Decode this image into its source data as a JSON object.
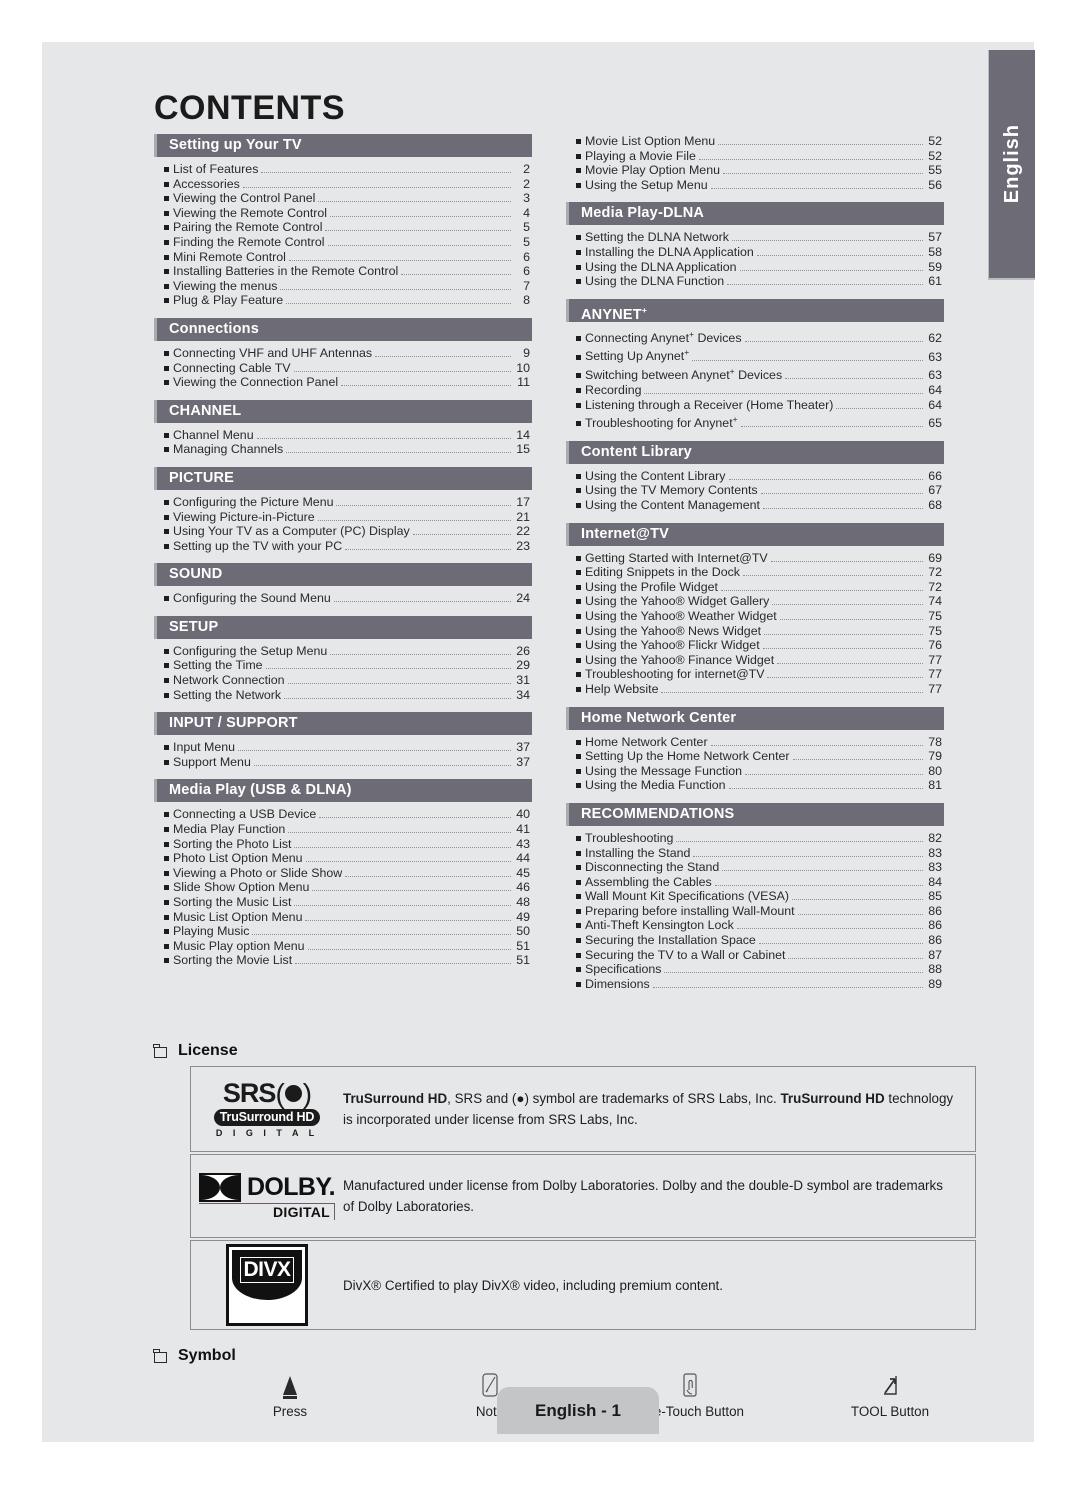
{
  "page": {
    "title": "CONTENTS",
    "language_tab": "English",
    "footer": "English - 1"
  },
  "toc": {
    "left_column": [
      {
        "header": "Setting up Your TV",
        "entries": [
          {
            "title": "List of Features",
            "page": "2"
          },
          {
            "title": "Accessories",
            "page": "2"
          },
          {
            "title": "Viewing the Control Panel",
            "page": "3"
          },
          {
            "title": "Viewing the Remote Control",
            "page": "4"
          },
          {
            "title": "Pairing the Remote Control",
            "page": "5"
          },
          {
            "title": "Finding the Remote Control",
            "page": "5"
          },
          {
            "title": "Mini Remote Control",
            "page": "6"
          },
          {
            "title": "Installing Batteries in the Remote Control",
            "page": "6"
          },
          {
            "title": "Viewing the menus",
            "page": "7"
          },
          {
            "title": "Plug & Play Feature",
            "page": "8"
          }
        ]
      },
      {
        "header": "Connections",
        "entries": [
          {
            "title": "Connecting VHF and UHF Antennas",
            "page": "9"
          },
          {
            "title": "Connecting Cable TV",
            "page": "10"
          },
          {
            "title": "Viewing the Connection Panel",
            "page": "11"
          }
        ]
      },
      {
        "header": "CHANNEL",
        "entries": [
          {
            "title": "Channel Menu",
            "page": "14"
          },
          {
            "title": "Managing Channels",
            "page": "15"
          }
        ]
      },
      {
        "header": "PICTURE",
        "entries": [
          {
            "title": "Configuring the Picture Menu",
            "page": "17"
          },
          {
            "title": "Viewing Picture-in-Picture",
            "page": "21"
          },
          {
            "title": "Using Your TV as a Computer (PC) Display",
            "page": "22"
          },
          {
            "title": "Setting up the TV with your PC",
            "page": "23"
          }
        ]
      },
      {
        "header": "SOUND",
        "entries": [
          {
            "title": "Configuring the Sound Menu",
            "page": "24"
          }
        ]
      },
      {
        "header": "SETUP",
        "entries": [
          {
            "title": "Configuring the Setup Menu",
            "page": "26"
          },
          {
            "title": "Setting the Time",
            "page": "29"
          },
          {
            "title": "Network Connection",
            "page": "31"
          },
          {
            "title": "Setting the Network",
            "page": "34"
          }
        ]
      },
      {
        "header": "INPUT / SUPPORT",
        "entries": [
          {
            "title": "Input Menu",
            "page": "37"
          },
          {
            "title": "Support Menu",
            "page": "37"
          }
        ]
      },
      {
        "header": "Media Play (USB & DLNA)",
        "entries": [
          {
            "title": "Connecting a USB Device",
            "page": "40"
          },
          {
            "title": "Media Play Function",
            "page": "41"
          },
          {
            "title": "Sorting the Photo List",
            "page": "43"
          },
          {
            "title": "Photo List Option Menu",
            "page": "44"
          },
          {
            "title": "Viewing a Photo or Slide Show",
            "page": "45"
          },
          {
            "title": "Slide Show Option Menu",
            "page": "46"
          },
          {
            "title": "Sorting the Music List",
            "page": "48"
          },
          {
            "title": "Music List Option Menu",
            "page": "49"
          },
          {
            "title": "Playing Music",
            "page": "50"
          },
          {
            "title": "Music Play option Menu",
            "page": "51"
          },
          {
            "title": "Sorting the Movie List",
            "page": "51"
          }
        ]
      }
    ],
    "right_column": [
      {
        "header": "",
        "entries": [
          {
            "title": "Movie List Option Menu",
            "page": "52"
          },
          {
            "title": "Playing a Movie File",
            "page": "52"
          },
          {
            "title": "Movie Play Option Menu",
            "page": "55"
          },
          {
            "title": "Using the Setup Menu",
            "page": "56"
          }
        ]
      },
      {
        "header": "Media Play-DLNA",
        "entries": [
          {
            "title": "Setting the DLNA Network",
            "page": "57"
          },
          {
            "title": "Installing the DLNA Application",
            "page": "58"
          },
          {
            "title": "Using the DLNA Application",
            "page": "59"
          },
          {
            "title": "Using the DLNA Function",
            "page": "61"
          }
        ]
      },
      {
        "header": "ANYNET+",
        "header_sup": "+",
        "header_base": "ANYNET",
        "entries": [
          {
            "title": "Connecting Anynet+ Devices",
            "page": "62",
            "base": "Connecting Anynet",
            "sup": "+",
            "rest": " Devices"
          },
          {
            "title": "Setting Up Anynet+",
            "page": "63",
            "base": "Setting Up Anynet",
            "sup": "+",
            "rest": ""
          },
          {
            "title": "Switching between Anynet+ Devices",
            "page": "63",
            "base": "Switching between Anynet",
            "sup": "+",
            "rest": " Devices"
          },
          {
            "title": "Recording",
            "page": "64"
          },
          {
            "title": "Listening through a Receiver (Home Theater)",
            "page": "64"
          },
          {
            "title": "Troubleshooting for Anynet+",
            "page": "65",
            "base": "Troubleshooting for Anynet",
            "sup": "+",
            "rest": ""
          }
        ]
      },
      {
        "header": "Content Library",
        "entries": [
          {
            "title": "Using the Content Library",
            "page": "66"
          },
          {
            "title": "Using the TV Memory Contents",
            "page": "67"
          },
          {
            "title": "Using the Content Management",
            "page": "68"
          }
        ]
      },
      {
        "header": "Internet@TV",
        "entries": [
          {
            "title": "Getting Started with Internet@TV",
            "page": "69"
          },
          {
            "title": "Editing Snippets in the Dock",
            "page": "72"
          },
          {
            "title": "Using the Profile Widget",
            "page": "72"
          },
          {
            "title": "Using the Yahoo® Widget Gallery",
            "page": "74"
          },
          {
            "title": "Using the Yahoo® Weather Widget",
            "page": "75"
          },
          {
            "title": "Using the Yahoo® News Widget",
            "page": "75"
          },
          {
            "title": "Using the Yahoo® Flickr Widget",
            "page": "76"
          },
          {
            "title": "Using the Yahoo® Finance Widget",
            "page": "77"
          },
          {
            "title": "Troubleshooting for internet@TV",
            "page": "77"
          },
          {
            "title": "Help Website",
            "page": "77"
          }
        ]
      },
      {
        "header": "Home Network Center",
        "entries": [
          {
            "title": "Home Network Center",
            "page": "78"
          },
          {
            "title": "Setting Up the Home Network Center",
            "page": "79"
          },
          {
            "title": "Using the Message Function",
            "page": "80"
          },
          {
            "title": "Using the Media Function",
            "page": "81"
          }
        ]
      },
      {
        "header": "RECOMMENDATIONS",
        "entries": [
          {
            "title": "Troubleshooting",
            "page": "82"
          },
          {
            "title": "Installing the Stand",
            "page": "83"
          },
          {
            "title": "Disconnecting the Stand",
            "page": "83"
          },
          {
            "title": "Assembling the Cables",
            "page": "84"
          },
          {
            "title": "Wall Mount Kit Specifications (VESA)",
            "page": "85"
          },
          {
            "title": "Preparing before installing Wall-Mount",
            "page": "86"
          },
          {
            "title": "Anti-Theft Kensington Lock",
            "page": "86"
          },
          {
            "title": "Securing the Installation Space",
            "page": "86"
          },
          {
            "title": "Securing the TV to a Wall or Cabinet",
            "page": "87"
          },
          {
            "title": "Specifications",
            "page": "88"
          },
          {
            "title": "Dimensions",
            "page": "89"
          }
        ]
      }
    ]
  },
  "license": {
    "heading": "License",
    "items": [
      {
        "logo": "srs-trusurround-hd-logo",
        "logo_text": {
          "line1": "SRS",
          "line2": "TruSurround HD",
          "line3": "D I G I T A L"
        },
        "text_html": "TruSurround HD, SRS and (●) symbol are trademarks of SRS Labs, Inc. TruSurround HD technology is incorporated under license from SRS Labs, Inc.",
        "text_part1": "TruSurround HD",
        "text_part2": ", SRS and ",
        "text_part3": " symbol are trademarks of SRS Labs, Inc. ",
        "text_part4": "TruSurround HD",
        "text_part5": " technology is incorporated under license from SRS Labs, Inc."
      },
      {
        "logo": "dolby-digital-logo",
        "logo_text": {
          "line1": "DOLBY.",
          "line2": "DIGITAL"
        },
        "text": "Manufactured under license from Dolby Laboratories. Dolby and the double-D symbol are trademarks of Dolby Laboratories."
      },
      {
        "logo": "divx-logo",
        "logo_text": {
          "line1": "DIVX"
        },
        "text": "DivX® Certified to play DivX® video, including premium content."
      }
    ]
  },
  "symbol": {
    "heading": "Symbol",
    "items": [
      {
        "icon": "press-arrow-icon",
        "label": "Press"
      },
      {
        "icon": "note-pencil-icon",
        "label": "Note"
      },
      {
        "icon": "one-touch-button-icon",
        "label": "One-Touch Button"
      },
      {
        "icon": "tool-button-icon",
        "label": "TOOL Button"
      }
    ]
  },
  "colors": {
    "page_background": "#e6e7e9",
    "section_header": "#6d6c76",
    "section_header_accent": "#a9abb0",
    "footer_tab": "#c4c5c7",
    "text": "#1d1d1d"
  }
}
